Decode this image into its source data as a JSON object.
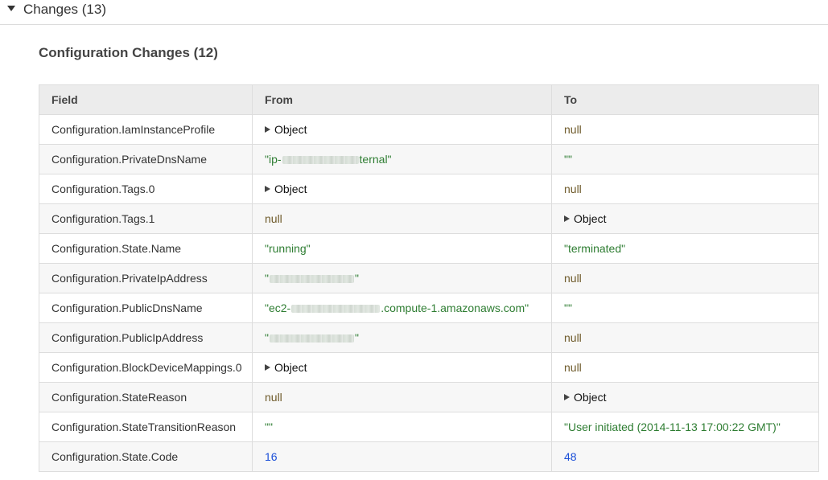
{
  "section": {
    "title": "Changes (13)"
  },
  "config": {
    "title": "Configuration Changes (12)"
  },
  "table": {
    "headers": [
      "Field",
      "From",
      "To"
    ],
    "rows": [
      {
        "field": "Configuration.IamInstanceProfile",
        "from": {
          "kind": "object",
          "text": "Object"
        },
        "to": {
          "kind": "null",
          "text": "null"
        }
      },
      {
        "field": "Configuration.PrivateDnsName",
        "from": {
          "kind": "string",
          "pre": "\"ip-",
          "post": "ternal\"",
          "blur_widths": [
            95
          ]
        },
        "to": {
          "kind": "string",
          "text": "\"\""
        }
      },
      {
        "field": "Configuration.Tags.0",
        "from": {
          "kind": "object",
          "text": "Object"
        },
        "to": {
          "kind": "null",
          "text": "null"
        }
      },
      {
        "field": "Configuration.Tags.1",
        "from": {
          "kind": "null",
          "text": "null"
        },
        "to": {
          "kind": "object",
          "text": "Object"
        }
      },
      {
        "field": "Configuration.State.Name",
        "from": {
          "kind": "string",
          "text": "\"running\""
        },
        "to": {
          "kind": "string",
          "text": "\"terminated\""
        }
      },
      {
        "field": "Configuration.PrivateIpAddress",
        "from": {
          "kind": "string",
          "pre": "\"",
          "post": "\"",
          "blur_widths": [
            105
          ]
        },
        "to": {
          "kind": "null",
          "text": "null"
        }
      },
      {
        "field": "Configuration.PublicDnsName",
        "from": {
          "kind": "string",
          "pre": "\"ec2-",
          "post": ".compute-1.amazonaws.com\"",
          "blur_widths": [
            110
          ]
        },
        "to": {
          "kind": "string",
          "text": "\"\""
        }
      },
      {
        "field": "Configuration.PublicIpAddress",
        "from": {
          "kind": "string",
          "pre": "\"",
          "post": "\"",
          "blur_widths": [
            105
          ]
        },
        "to": {
          "kind": "null",
          "text": "null"
        }
      },
      {
        "field": "Configuration.BlockDeviceMappings.0",
        "from": {
          "kind": "object",
          "text": "Object"
        },
        "to": {
          "kind": "null",
          "text": "null"
        }
      },
      {
        "field": "Configuration.StateReason",
        "from": {
          "kind": "null",
          "text": "null"
        },
        "to": {
          "kind": "object",
          "text": "Object"
        }
      },
      {
        "field": "Configuration.StateTransitionReason",
        "from": {
          "kind": "string",
          "text": "\"\""
        },
        "to": {
          "kind": "string",
          "text": "\"User initiated (2014-11-13 17:00:22 GMT)\""
        }
      },
      {
        "field": "Configuration.State.Code",
        "from": {
          "kind": "number",
          "text": "16"
        },
        "to": {
          "kind": "number",
          "text": "48"
        }
      }
    ]
  },
  "colors": {
    "null": "#6e5a2a",
    "string": "#2e7d32",
    "number": "#1b4fd8",
    "object": "#111111"
  },
  "icons": {
    "section_toggle": "caret-down-icon",
    "object_expand": "caret-right-icon"
  }
}
